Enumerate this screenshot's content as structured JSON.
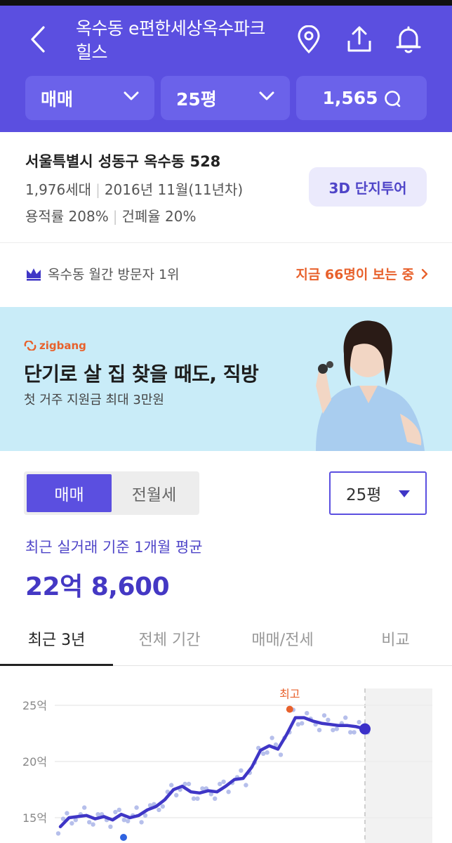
{
  "header": {
    "title": "옥수동 e편한세상옥수파크힐스",
    "icons": [
      "back-arrow-icon",
      "location-pin-icon",
      "share-icon",
      "bell-icon"
    ],
    "filters": [
      {
        "label": "매매"
      },
      {
        "label": "25평"
      },
      {
        "label": "1,565"
      }
    ]
  },
  "info": {
    "address": "서울특별시 성동구 옥수동 528",
    "households": "1,976세대",
    "built": "2016년 11월(11년차)",
    "floor_area_ratio": "용적률 208%",
    "coverage_ratio": "건폐율 20%",
    "tour_button": "3D 단지투어"
  },
  "rank": {
    "text": "옥수동 월간 방문자 1위",
    "viewers": "지금 66명이 보는 중"
  },
  "banner": {
    "logo": "zigbang",
    "headline": "단기로 살 집 찾을 때도, 직방",
    "subtext": "첫 거주 지원금 최대 3만원"
  },
  "price": {
    "trade_type_selected": "매매",
    "trade_type_other": "전월세",
    "size_select": "25평",
    "avg_label": "최근 실거래 기준 1개월 평균",
    "avg_value": "22억 8,600"
  },
  "tabs": [
    "최근 3년",
    "전체 기간",
    "매매/전세",
    "비교"
  ],
  "colors": {
    "brand": "#5b4fe0",
    "accent_orange": "#e8612c",
    "line": "#3f36c6"
  },
  "chart_data": {
    "type": "line",
    "yticks": [
      "25억",
      "20억",
      "15억"
    ],
    "y_values_tick": [
      25,
      20,
      15
    ],
    "ylim": [
      14,
      26
    ],
    "annotation": "최고",
    "series": [
      {
        "x": [
          0,
          1,
          2,
          3,
          4,
          5,
          6,
          7,
          8,
          9,
          10,
          11,
          12,
          13,
          14,
          15,
          16,
          17,
          18,
          19,
          20,
          21,
          22,
          23,
          24,
          25,
          26,
          27,
          28,
          29,
          30,
          31,
          32,
          33,
          34,
          35
        ],
        "values": [
          14.2,
          15.0,
          15.1,
          15.2,
          14.9,
          15.1,
          14.8,
          15.3,
          15.0,
          15.2,
          15.7,
          16.0,
          16.6,
          17.5,
          17.8,
          17.3,
          17.2,
          17.4,
          17.3,
          17.8,
          18.4,
          18.5,
          19.5,
          21.0,
          21.4,
          21.1,
          22.4,
          23.9,
          23.9,
          23.6,
          23.4,
          23.3,
          23.2,
          23.2,
          23.1,
          22.9
        ]
      }
    ]
  }
}
